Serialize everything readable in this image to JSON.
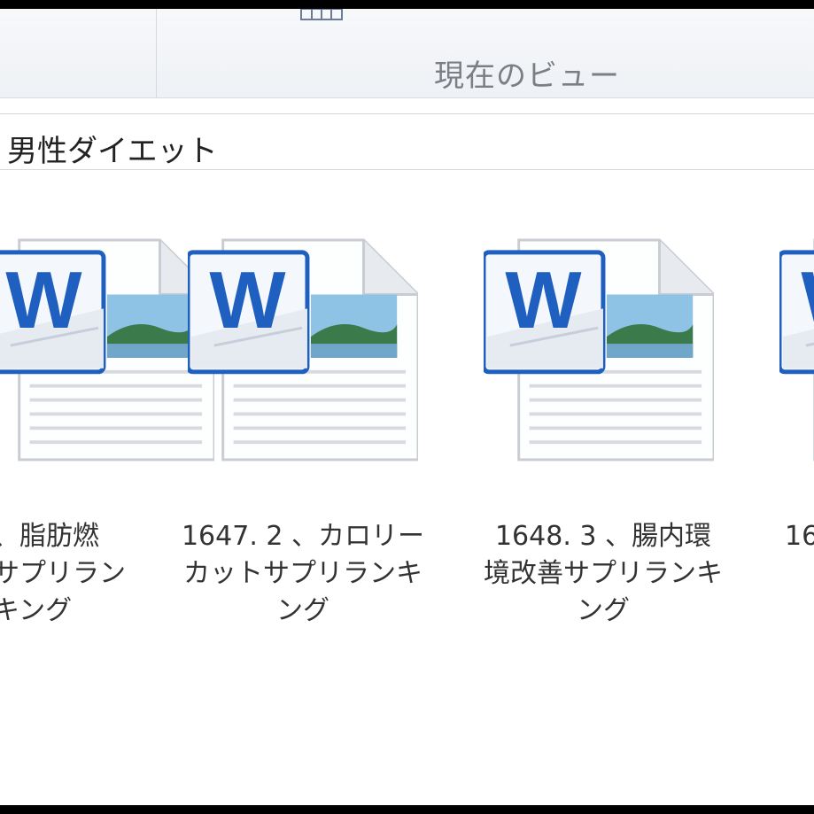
{
  "ribbon": {
    "group_label": "現在のビュー"
  },
  "address_bar": {
    "path": "男性ダイエット"
  },
  "files": [
    {
      "name": "、脂肪燃\nサプリランキング",
      "icon": "word-document-icon"
    },
    {
      "name": "1647. 2 、カロリーカットサプリランキング",
      "icon": "word-document-icon"
    },
    {
      "name": "1648. 3 、腸内環境改善サプリランキング",
      "icon": "word-document-icon"
    },
    {
      "name": "16",
      "icon": "word-document-icon"
    }
  ],
  "colors": {
    "word_blue": "#1f5fbf",
    "ribbon_bg": "#eef1f5"
  }
}
